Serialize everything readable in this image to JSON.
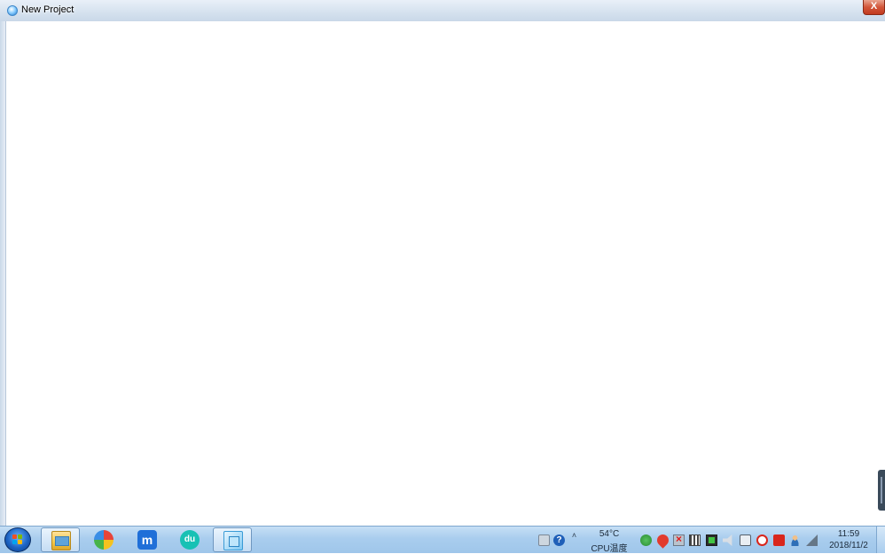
{
  "window": {
    "title": "New Project",
    "close_label": "X"
  },
  "taskbar": {
    "start_label": "Start",
    "apps": [
      {
        "name": "Windows Explorer",
        "icon": "folder-icon",
        "active": true
      },
      {
        "name": "360 Browser",
        "icon": "browser-360-icon",
        "active": false
      },
      {
        "name": "Maxthon",
        "icon": "maxthon-icon",
        "glyph": "m",
        "active": false
      },
      {
        "name": "Music",
        "icon": "headphones-icon",
        "glyph": "du",
        "active": false
      },
      {
        "name": "New Project",
        "icon": "cube-icon",
        "active": true
      }
    ],
    "tray": {
      "cpu_temp": "54°C",
      "cpu_label": "CPU温度",
      "time": "11:59",
      "date": "2018/11/2",
      "help_glyph": "?",
      "chevron_glyph": "˄"
    }
  }
}
